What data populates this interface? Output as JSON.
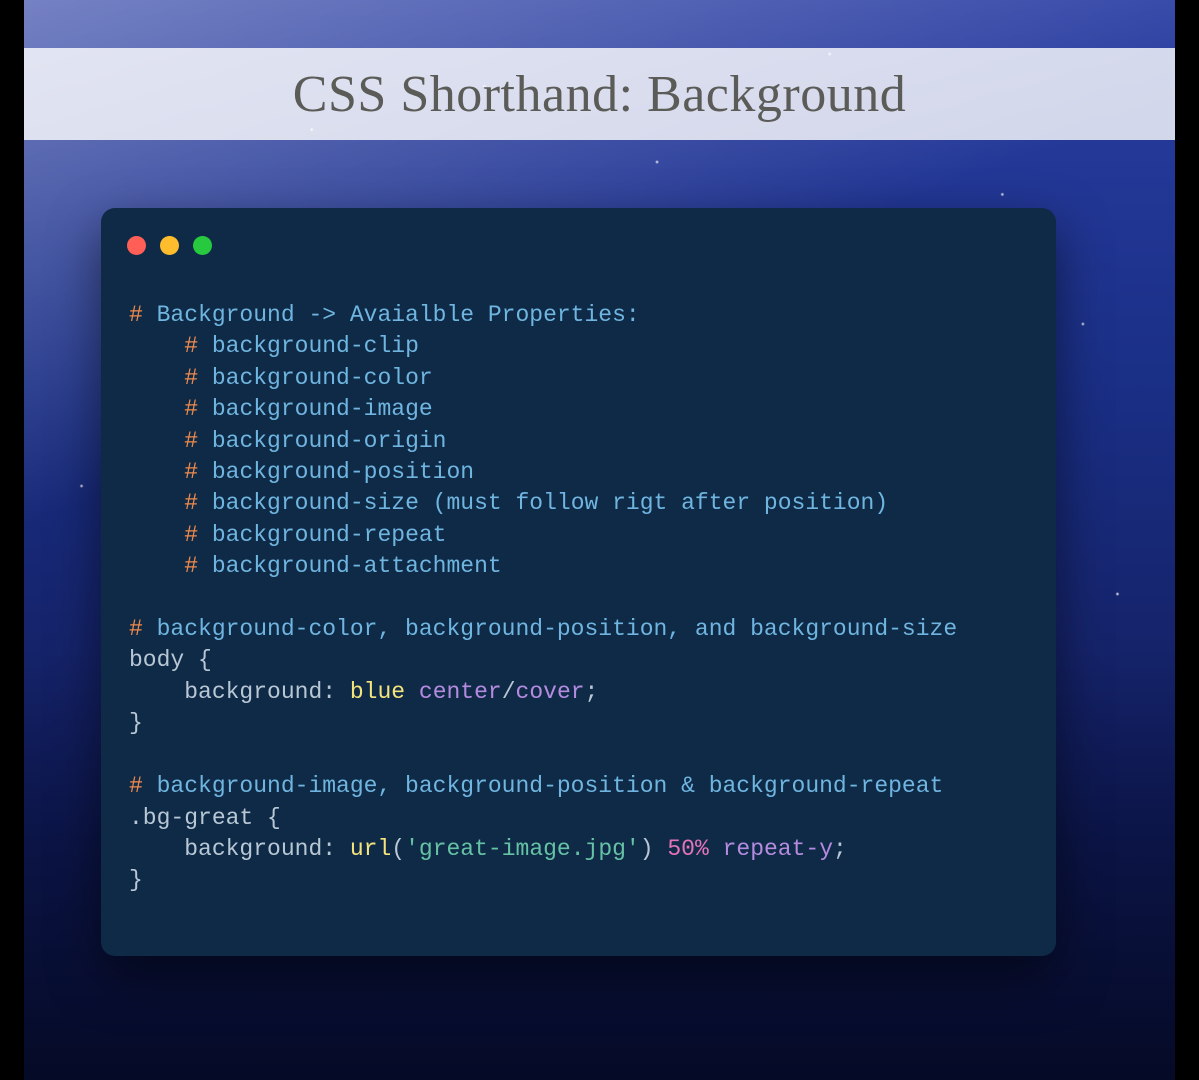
{
  "title": "CSS Shorthand: Background",
  "window": {
    "traffic": [
      "red",
      "yellow",
      "green"
    ]
  },
  "code": {
    "line1_hash": "#",
    "line1_text": " Background -> Avaialble Properties:",
    "prop_indent": "    ",
    "props": [
      " background-clip",
      " background-color",
      " background-image",
      " background-origin",
      " background-position",
      " background-size (must follow rigt after position)",
      " background-repeat",
      " background-attachment"
    ],
    "comment2": " background-color, background-position, and background-size",
    "body_sel": "body {",
    "body_indent": "    ",
    "body_prop": "background: ",
    "body_val_blue": "blue",
    "body_sp1": " ",
    "body_val_center": "center",
    "body_slash": "/",
    "body_val_cover": "cover",
    "body_semi": ";",
    "body_close": "}",
    "comment3": " background-image, background-position & background-repeat",
    "bg_sel": ".bg-great {",
    "bg_indent": "    ",
    "bg_prop": "background: ",
    "bg_url": "url",
    "bg_paren_open": "(",
    "bg_string": "'great-image.jpg'",
    "bg_paren_close": ")",
    "bg_sp1": " ",
    "bg_num": "50%",
    "bg_sp2": " ",
    "bg_repeat": "repeat-y",
    "bg_semi": ";",
    "bg_close": "}"
  }
}
